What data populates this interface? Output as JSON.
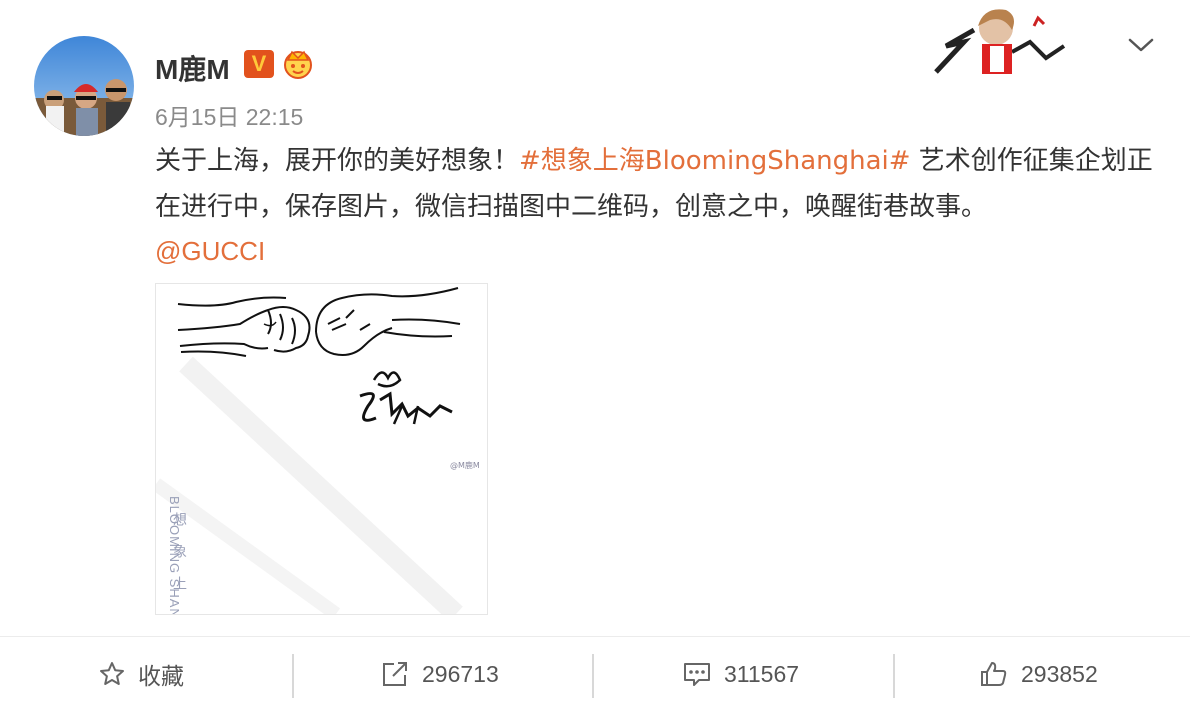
{
  "post": {
    "author": "M鹿M",
    "verified_badge": "V",
    "timestamp": "6月15日 22:15",
    "text_before": "关于上海，展开你的美好想象！",
    "topic": "#想象上海BloomingShanghai#",
    "text_after": " 艺术创作征集企划正在进行中，保存图片，微信扫描图中二维码，创意之中，唤醒街巷故事。",
    "mention": "@GUCCI"
  },
  "image": {
    "watermark": "@M鹿M",
    "vertical_cn": "想象上",
    "vertical_en": "BLOOMING SHAN"
  },
  "actions": {
    "favorite_label": "收藏",
    "repost_count": "296713",
    "comment_count": "311567",
    "like_count": "293852"
  },
  "colors": {
    "accent": "#e36f3b",
    "text": "#333333",
    "secondary": "#8a8a8a",
    "badge": "#e2521d"
  },
  "icons": [
    "chevron-down-icon",
    "star-icon",
    "repost-icon",
    "comment-icon",
    "thumbs-up-icon",
    "crown-icon"
  ]
}
